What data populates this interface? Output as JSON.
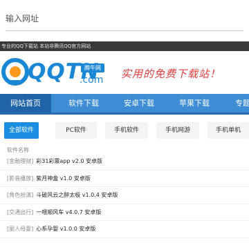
{
  "urlbar": {
    "placeholder": "输入网址"
  },
  "notice": {
    "text": "专业的QQ下载站 本站非腾讯QQ官方网站"
  },
  "logo": {
    "text": "QQTN",
    "badge": "腾牛网",
    "dotcom": ".com",
    "slogan": "实用的免费下载站！",
    "brand_color": "#1a86d6",
    "slogan_color": "#e23b3b"
  },
  "nav": {
    "items": [
      {
        "label": "网站首页",
        "active": true
      },
      {
        "label": "软件下载",
        "active": false
      },
      {
        "label": "安卓下载",
        "active": false
      },
      {
        "label": "苹果下载",
        "active": false
      },
      {
        "label": "专题",
        "active": false
      }
    ],
    "bar_color": "#3d8cd4",
    "active_color": "#1f63a8"
  },
  "categories": {
    "items": [
      {
        "label": "全部软件",
        "active": true
      },
      {
        "label": "PC软件",
        "active": false
      },
      {
        "label": "手机软件",
        "active": false
      },
      {
        "label": "手机网游",
        "active": false
      },
      {
        "label": "手机单机",
        "active": false
      }
    ],
    "active_color": "#1a8ee0"
  },
  "list": {
    "header": "软件名称",
    "rows": [
      {
        "category": "[金融理财]",
        "title": "彩31彩票app v2.0 安卓版"
      },
      {
        "category": "[影音播放]",
        "title": "紫月神盒 v1.0 安卓版"
      },
      {
        "category": "[角色扮演]",
        "title": "斗破风云之醉太极 v1.0.4 安卓版"
      },
      {
        "category": "[交通出行]",
        "title": "一喂顺风车 v4.0.7 安卓版"
      },
      {
        "category": "[丽人母婴]",
        "title": "心系孕婴 v1.0.0 安卓版"
      }
    ]
  }
}
